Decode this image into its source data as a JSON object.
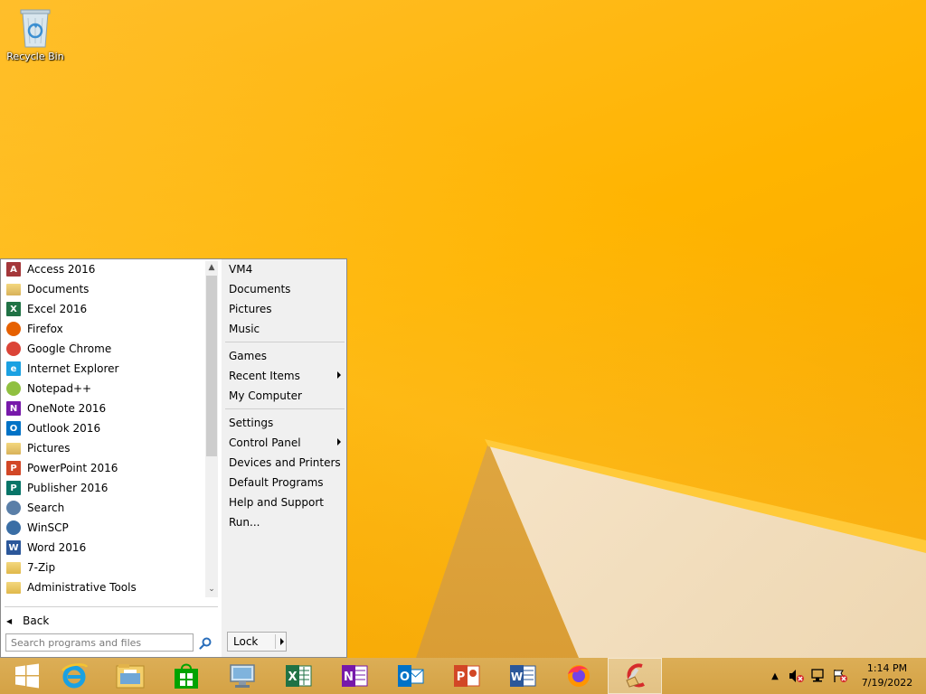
{
  "desktop": {
    "icons": [
      {
        "label": "Recycle Bin",
        "icon": "recycle-bin-icon"
      }
    ]
  },
  "start_menu": {
    "programs": [
      {
        "label": "Access 2016",
        "icon": "access-icon",
        "color": "#a4373a",
        "glyph": "A"
      },
      {
        "label": "Documents",
        "icon": "folder-documents-icon",
        "color": "#d8b25a",
        "glyph": ""
      },
      {
        "label": "Excel 2016",
        "icon": "excel-icon",
        "color": "#207245",
        "glyph": "X"
      },
      {
        "label": "Firefox",
        "icon": "firefox-icon",
        "color": "#e66000",
        "glyph": ""
      },
      {
        "label": "Google Chrome",
        "icon": "chrome-icon",
        "color": "#db4437",
        "glyph": ""
      },
      {
        "label": "Internet Explorer",
        "icon": "ie-icon",
        "color": "#1ba1e2",
        "glyph": "e"
      },
      {
        "label": "Notepad++",
        "icon": "notepadpp-icon",
        "color": "#90c040",
        "glyph": ""
      },
      {
        "label": "OneNote 2016",
        "icon": "onenote-icon",
        "color": "#7719aa",
        "glyph": "N"
      },
      {
        "label": "Outlook 2016",
        "icon": "outlook-icon",
        "color": "#0072c6",
        "glyph": "O"
      },
      {
        "label": "Pictures",
        "icon": "folder-pictures-icon",
        "color": "#d8b25a",
        "glyph": ""
      },
      {
        "label": "PowerPoint 2016",
        "icon": "powerpoint-icon",
        "color": "#d24726",
        "glyph": "P"
      },
      {
        "label": "Publisher 2016",
        "icon": "publisher-icon",
        "color": "#077568",
        "glyph": "P"
      },
      {
        "label": "Search",
        "icon": "search-icon",
        "color": "#5a7fa8",
        "glyph": ""
      },
      {
        "label": "WinSCP",
        "icon": "winscp-icon",
        "color": "#3a6ea5",
        "glyph": ""
      },
      {
        "label": "Word 2016",
        "icon": "word-icon",
        "color": "#2b579a",
        "glyph": "W"
      },
      {
        "label": "7-Zip",
        "icon": "folder-icon",
        "color": "#e0b84a",
        "glyph": ""
      },
      {
        "label": "Administrative Tools",
        "icon": "folder-icon",
        "color": "#e0b84a",
        "glyph": ""
      }
    ],
    "back_label": "Back",
    "search_placeholder": "Search programs and files",
    "right_groups": [
      [
        {
          "label": "VM4"
        },
        {
          "label": "Documents"
        },
        {
          "label": "Pictures"
        },
        {
          "label": "Music"
        }
      ],
      [
        {
          "label": "Games"
        },
        {
          "label": "Recent Items",
          "submenu": true
        },
        {
          "label": "My Computer"
        }
      ],
      [
        {
          "label": "Settings"
        },
        {
          "label": "Control Panel",
          "submenu": true
        },
        {
          "label": "Devices and Printers"
        },
        {
          "label": "Default Programs"
        },
        {
          "label": "Help and Support"
        },
        {
          "label": "Run..."
        }
      ]
    ],
    "lock_label": "Lock"
  },
  "taskbar": {
    "pinned": [
      {
        "name": "start-button",
        "icon": "windows-logo-icon"
      },
      {
        "name": "taskbar-internet-explorer",
        "icon": "ie-icon"
      },
      {
        "name": "taskbar-file-explorer",
        "icon": "file-explorer-icon"
      },
      {
        "name": "taskbar-store",
        "icon": "store-icon"
      },
      {
        "name": "taskbar-remote-desktop",
        "icon": "remote-desktop-icon"
      },
      {
        "name": "taskbar-excel",
        "icon": "excel-icon"
      },
      {
        "name": "taskbar-onenote",
        "icon": "onenote-icon"
      },
      {
        "name": "taskbar-outlook",
        "icon": "outlook-icon"
      },
      {
        "name": "taskbar-powerpoint",
        "icon": "powerpoint-icon"
      },
      {
        "name": "taskbar-word",
        "icon": "word-icon"
      },
      {
        "name": "taskbar-firefox",
        "icon": "firefox-icon"
      },
      {
        "name": "taskbar-ccleaner",
        "icon": "ccleaner-icon"
      }
    ],
    "tray_icons": [
      "show-hidden-icons-icon",
      "volume-muted-icon",
      "network-icon",
      "action-center-icon"
    ],
    "clock": {
      "time": "1:14 PM",
      "date": "7/19/2022"
    }
  }
}
